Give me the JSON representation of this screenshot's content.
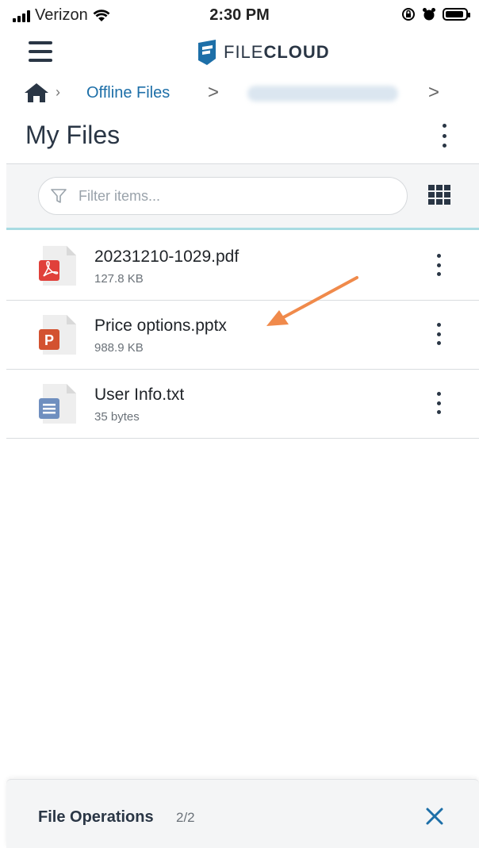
{
  "status_bar": {
    "carrier": "Verizon",
    "time": "2:30 PM"
  },
  "header": {
    "brand_text_light": "FILE",
    "brand_text_bold": "CLOUD"
  },
  "breadcrumb": {
    "home_icon": "home-icon",
    "offline_label": "Offline Files"
  },
  "page": {
    "title": "My Files"
  },
  "filter": {
    "placeholder": "Filter items..."
  },
  "files": [
    {
      "name": "20231210-1029.pdf",
      "size": "127.8 KB",
      "type": "pdf",
      "icon_color": "#e0403a"
    },
    {
      "name": "Price options.pptx",
      "size": "988.9 KB",
      "type": "pptx",
      "icon_color": "#d35230"
    },
    {
      "name": "User Info.txt",
      "size": "35 bytes",
      "type": "txt",
      "icon_color": "#6f8fbf"
    }
  ],
  "file_operations": {
    "label": "File Operations",
    "count": "2/2"
  },
  "colors": {
    "accent": "#1d6fa8",
    "annotation_arrow": "#f08a4b",
    "divider_active": "#a8dbe2"
  }
}
